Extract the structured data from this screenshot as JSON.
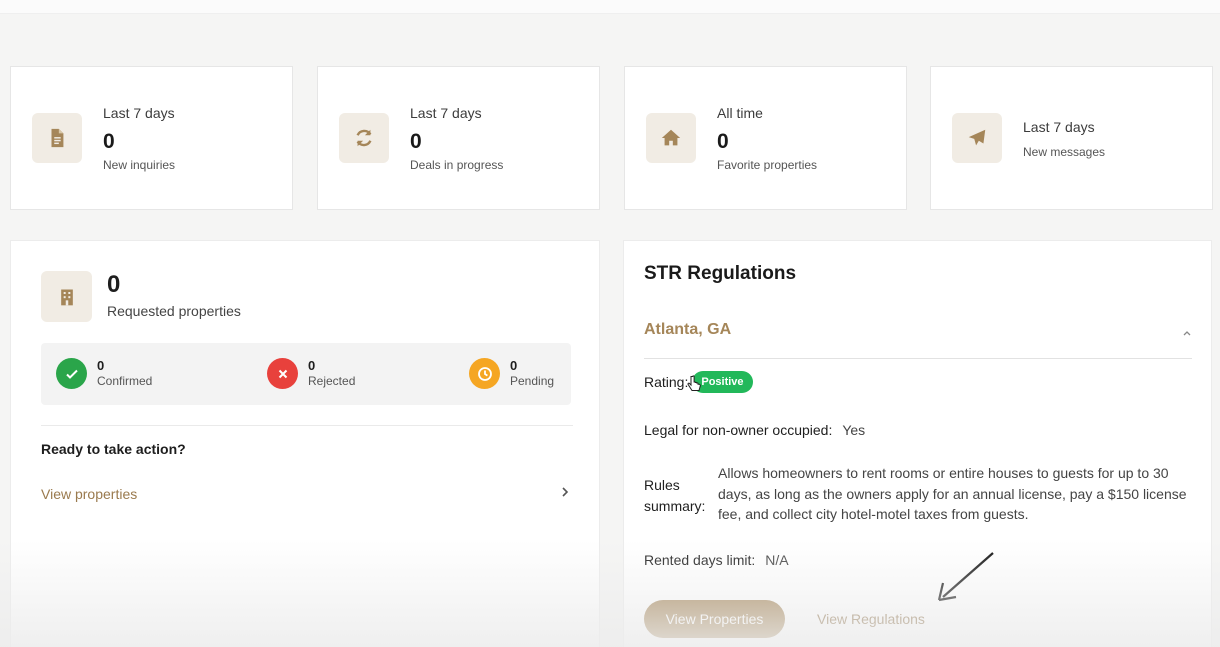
{
  "stats": [
    {
      "icon": "document-icon",
      "period": "Last 7 days",
      "value": "0",
      "caption": "New inquiries"
    },
    {
      "icon": "refresh-icon",
      "period": "Last 7 days",
      "value": "0",
      "caption": "Deals in progress"
    },
    {
      "icon": "home-icon",
      "period": "All time",
      "value": "0",
      "caption": "Favorite properties"
    },
    {
      "icon": "paper-plane-icon",
      "period": "Last 7 days",
      "caption": "New messages"
    }
  ],
  "requested": {
    "icon": "building-icon",
    "value": "0",
    "caption": "Requested properties",
    "statuses": [
      {
        "icon": "check-icon",
        "value": "0",
        "label": "Confirmed",
        "color": "#2aa54a"
      },
      {
        "icon": "x-icon",
        "value": "0",
        "label": "Rejected",
        "color": "#e8413c"
      },
      {
        "icon": "clock-icon",
        "value": "0",
        "label": "Pending",
        "color": "#f5a623"
      }
    ],
    "ready_title": "Ready to take action?",
    "view_link": "View properties"
  },
  "str": {
    "title": "STR Regulations",
    "city": "Atlanta, GA",
    "rating_label": "Rating:",
    "rating_badge": "Positive",
    "legal_label": "Legal for non-owner occupied:",
    "legal_value": "Yes",
    "rules_label": "Rules summary:",
    "rules_text": "Allows homeowners to rent rooms or entire houses to guests for up to 30 days, as long as the owners apply for an annual license, pay a $150 license fee, and collect city hotel-motel taxes from guests.",
    "limit_label": "Rented days limit:",
    "limit_value": "N/A",
    "btn_properties": "View Properties",
    "btn_regulations": "View Regulations"
  },
  "colors": {
    "accent": "#a58659",
    "icon_bg": "#f1ece4",
    "positive": "#22b85a"
  }
}
